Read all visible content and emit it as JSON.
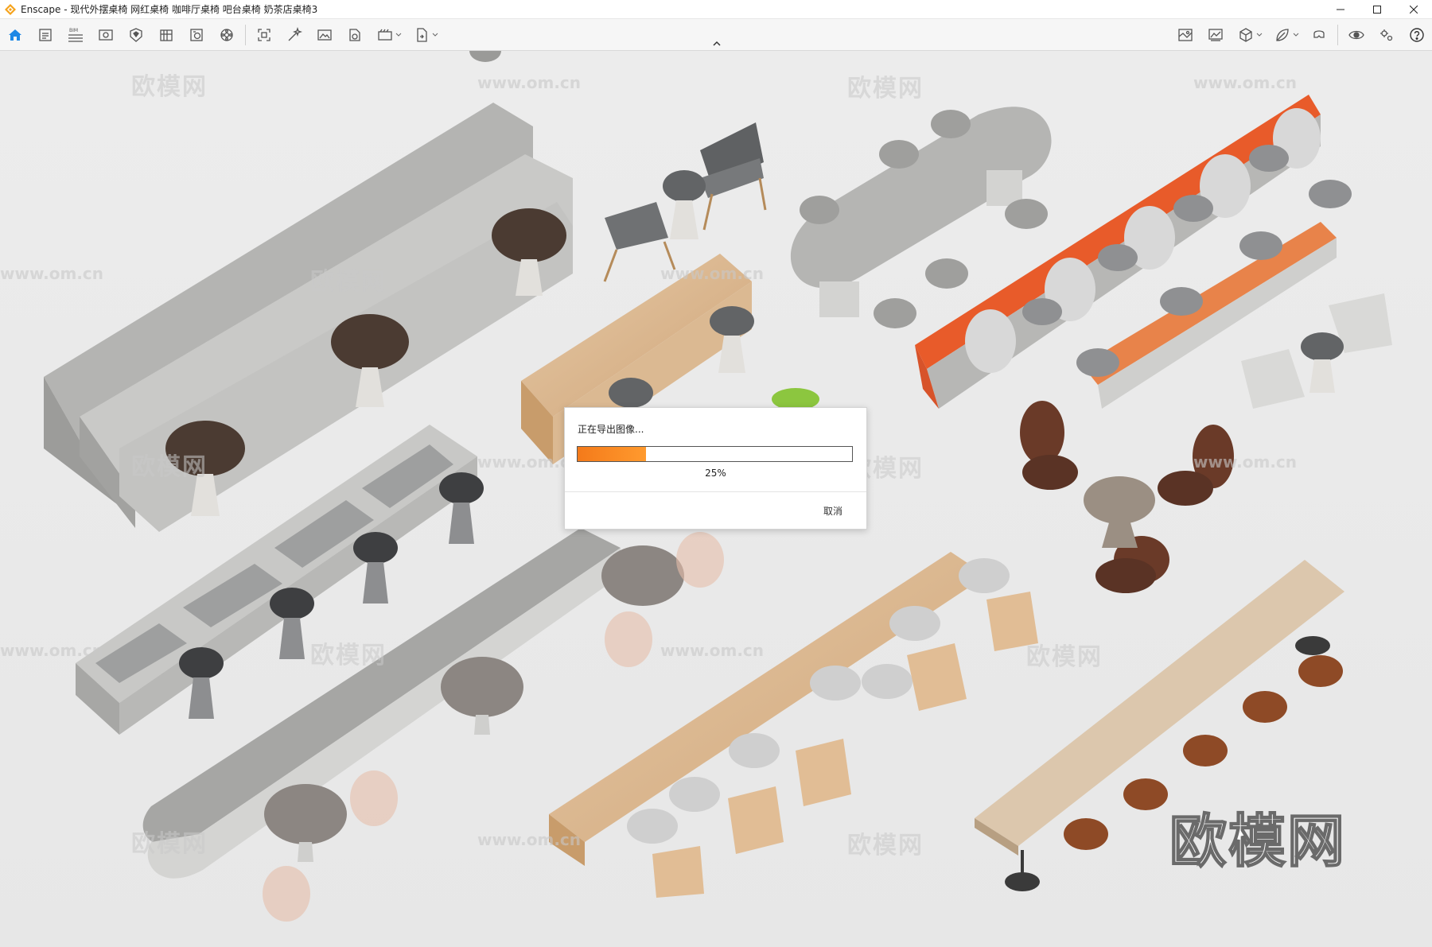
{
  "window": {
    "app_name": "Enscape",
    "title": "Enscape - 现代外摆桌椅 网红桌椅 咖啡厅桌椅 吧台桌椅 奶茶店桌椅3",
    "accent_color": "#1e88e5"
  },
  "toolbar": {
    "left_buttons": [
      {
        "icon": "home-icon",
        "active": true
      },
      {
        "icon": "project-info-icon"
      },
      {
        "icon": "bim-icon",
        "text": "BIM"
      },
      {
        "icon": "view-icon"
      },
      {
        "icon": "asset-library-icon"
      },
      {
        "icon": "material-icon"
      },
      {
        "icon": "info-panel-icon"
      },
      {
        "icon": "settings-wheel-icon"
      },
      {
        "icon": "screenshot-icon"
      },
      {
        "icon": "magic-wand-icon"
      },
      {
        "icon": "image-icon"
      },
      {
        "icon": "light-view-icon"
      },
      {
        "icon": "batch-render-icon"
      },
      {
        "icon": "export-icon"
      }
    ],
    "right_buttons": [
      {
        "icon": "map-icon"
      },
      {
        "icon": "gallery-icon"
      },
      {
        "icon": "cube-icon"
      },
      {
        "icon": "leaf-icon"
      },
      {
        "icon": "vr-headset-icon"
      },
      {
        "icon": "eye-settings-icon"
      },
      {
        "icon": "gear-icon"
      },
      {
        "icon": "help-icon"
      }
    ]
  },
  "viewport": {
    "watermark_text": "欧模网",
    "watermark_url": "www.om.cn",
    "brand_mark": "欧模网"
  },
  "export_dialog": {
    "title": "正在导出图像...",
    "progress": 0.25,
    "progress_label": "25%",
    "cancel_label": "取消",
    "progress_color": "#f47a1a"
  }
}
